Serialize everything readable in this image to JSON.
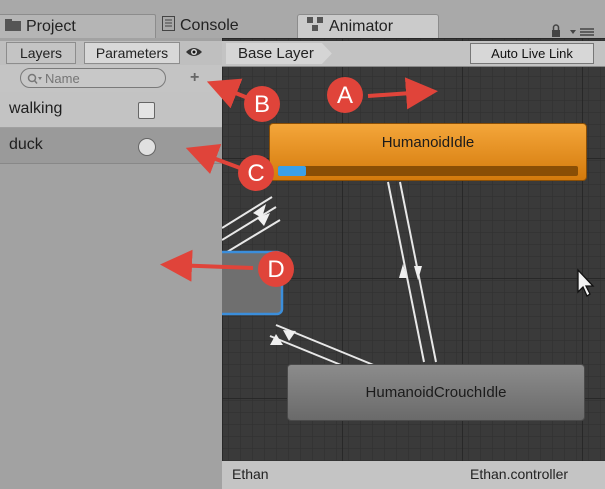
{
  "tabs": [
    {
      "label": "Project",
      "icon": "folder-icon"
    },
    {
      "label": "Console",
      "icon": "console-icon"
    },
    {
      "label": "Animator",
      "icon": "animator-icon"
    }
  ],
  "left_panel": {
    "subtabs": [
      "Layers",
      "Parameters"
    ],
    "search_placeholder": "Name",
    "add_label": "+",
    "parameters": [
      {
        "name": "walking",
        "type": "bool"
      },
      {
        "name": "duck",
        "type": "trigger"
      }
    ]
  },
  "graph": {
    "breadcrumb": "Base Layer",
    "auto_live_link": "Auto Live Link",
    "states": [
      {
        "name": "HumanoidIdle",
        "default": true,
        "progress": 0.12
      },
      {
        "name": "HumanoidCrouchIdle",
        "default": false
      }
    ],
    "footer_left": "Ethan",
    "footer_right": "Ethan.controller"
  },
  "callouts": [
    "A",
    "B",
    "C",
    "D"
  ],
  "colors": {
    "accent_orange": "#e88a14",
    "callout_red": "#e0443a",
    "progress_blue": "#3aa0e8"
  }
}
